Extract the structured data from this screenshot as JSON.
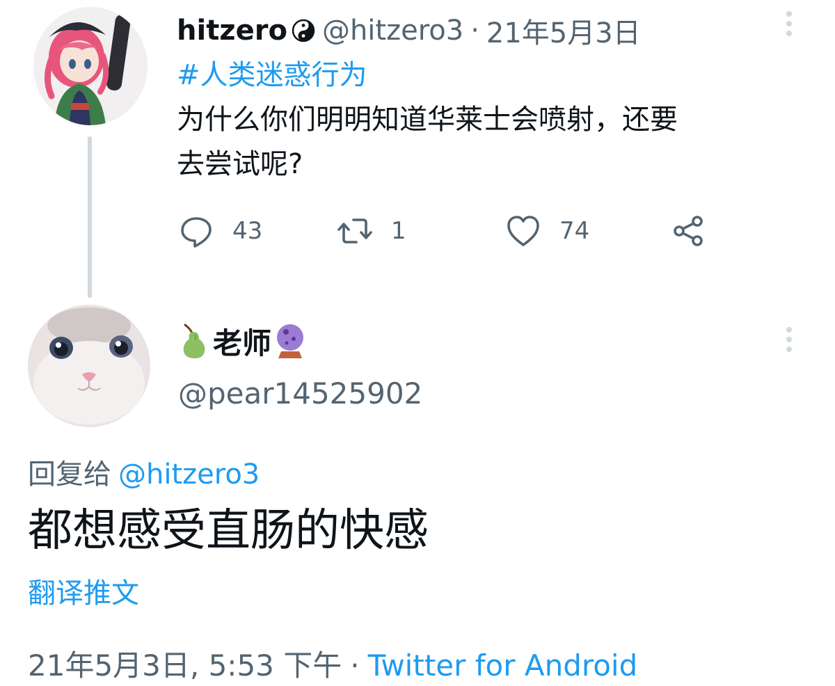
{
  "parent_tweet": {
    "display_name": "hitzero",
    "name_emoji_icon": "yin-yang-icon",
    "handle": "@hitzero3",
    "separator": "·",
    "date": "21年5月3日",
    "hashtag": "#人类迷惑行为",
    "text_line1": "为什么你们明明知道华莱士会喷射，还要",
    "text_line2": "去尝试呢?",
    "actions": {
      "reply_count": "43",
      "retweet_count": "1",
      "like_count": "74"
    },
    "avatar": "anime-girl-avatar"
  },
  "reply_tweet": {
    "display_name": "老师",
    "name_prefix_icon": "pear-icon",
    "name_suffix_icon": "crystal-ball-icon",
    "handle": "@pear14525902",
    "reply_to_label": "回复给",
    "reply_to_handle": "@hitzero3",
    "text": "都想感受直肠的快感",
    "translate_label": "翻译推文",
    "timestamp": "21年5月3日, 5:53 下午",
    "separator": "·",
    "source": "Twitter for Android",
    "avatar": "cat-face-avatar"
  },
  "colors": {
    "accent": "#1d9bf0",
    "secondary_text": "#536471",
    "thread_line": "#cfd9de"
  }
}
